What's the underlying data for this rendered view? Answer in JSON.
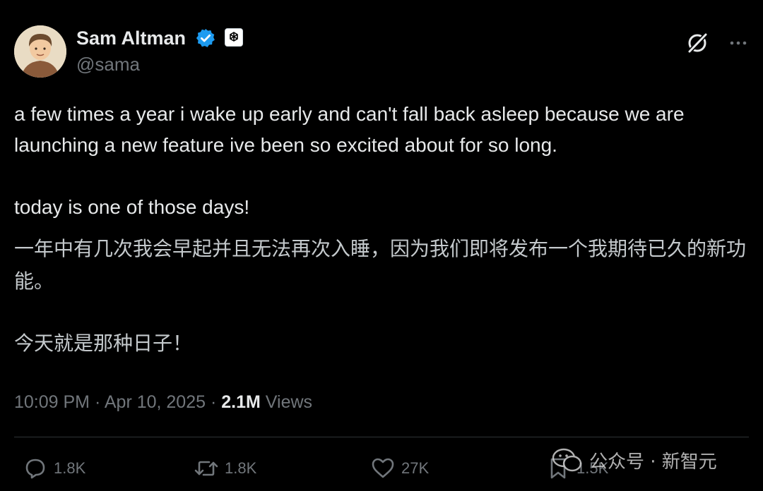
{
  "author": {
    "name": "Sam Altman",
    "handle": "@sama"
  },
  "tweet": {
    "line1": "a few times a year i wake up early and can't fall back asleep because we are launching a new feature ive been so excited about for so long.",
    "line2": "today is one of those days!",
    "translation1": "一年中有几次我会早起并且无法再次入睡，因为我们即将发布一个我期待已久的新功能。",
    "translation2": "今天就是那种日子！"
  },
  "meta": {
    "time": "10:09 PM",
    "separator": " · ",
    "date": "Apr 10, 2025",
    "views_count": "2.1M",
    "views_label": " Views"
  },
  "actions": {
    "replies": "1.8K",
    "retweets": "1.8K",
    "likes": "27K",
    "bookmarks": "1.5K"
  },
  "watermark": {
    "text": "公众号 · 新智元"
  },
  "icons": {
    "verified": "verified-badge-icon",
    "org": "openai-logo-icon",
    "grok": "grok-icon",
    "more": "more-options-icon",
    "reply": "reply-icon",
    "retweet": "retweet-icon",
    "like": "heart-icon",
    "bookmark": "bookmark-icon"
  },
  "colors": {
    "background": "#000000",
    "text": "#e7e9ea",
    "secondary": "#71767b",
    "verified": "#1d9bf0"
  }
}
